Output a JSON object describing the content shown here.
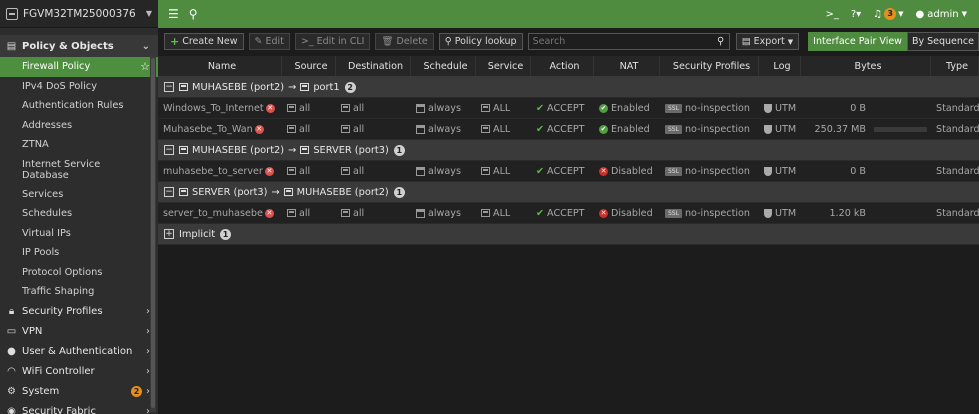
{
  "device": {
    "name": "FGVM32TM25000376"
  },
  "topbar": {
    "notifications": "3",
    "user": "admin"
  },
  "sidebar": {
    "active_section": "Policy & Objects",
    "items": [
      {
        "label": "Firewall Policy"
      },
      {
        "label": "IPv4 DoS Policy"
      },
      {
        "label": "Authentication Rules"
      },
      {
        "label": "Addresses"
      },
      {
        "label": "ZTNA"
      },
      {
        "label": "Internet Service Database"
      },
      {
        "label": "Services"
      },
      {
        "label": "Schedules"
      },
      {
        "label": "Virtual IPs"
      },
      {
        "label": "IP Pools"
      },
      {
        "label": "Protocol Options"
      },
      {
        "label": "Traffic Shaping"
      }
    ],
    "sections": [
      {
        "label": "Security Profiles"
      },
      {
        "label": "VPN"
      },
      {
        "label": "User & Authentication"
      },
      {
        "label": "WiFi Controller"
      },
      {
        "label": "System",
        "badge": "2"
      },
      {
        "label": "Security Fabric"
      }
    ]
  },
  "toolbar": {
    "create_new": "Create New",
    "edit": "Edit",
    "edit_cli": "Edit in CLI",
    "delete": "Delete",
    "policy_lookup": "Policy lookup",
    "search_placeholder": "Search",
    "export": "Export",
    "view_interface_pair": "Interface Pair View",
    "view_by_sequence": "By Sequence"
  },
  "table": {
    "columns": [
      "Name",
      "Source",
      "Destination",
      "Schedule",
      "Service",
      "Action",
      "NAT",
      "Security Profiles",
      "Log",
      "Bytes",
      "Type"
    ],
    "groups": [
      {
        "src_if": "MUHASEBE (port2)",
        "dst_if": "port1",
        "count": "2",
        "policies": [
          {
            "name": "Windows_To_Internet",
            "source": "all",
            "destination": "all",
            "schedule": "always",
            "service": "ALL",
            "action": "ACCEPT",
            "nat": "Enabled",
            "nat_enabled": true,
            "profile": "no-inspection",
            "ssl": "SSL",
            "log": "UTM",
            "bytes": "0 B",
            "type": "Standard"
          },
          {
            "name": "Muhasebe_To_Wan",
            "source": "all",
            "destination": "all",
            "schedule": "always",
            "service": "ALL",
            "action": "ACCEPT",
            "nat": "Enabled",
            "nat_enabled": true,
            "profile": "no-inspection",
            "ssl": "SSL",
            "log": "UTM",
            "bytes": "250.37 MB",
            "type": "Standard"
          }
        ]
      },
      {
        "src_if": "MUHASEBE (port2)",
        "dst_if": "SERVER (port3)",
        "count": "1",
        "policies": [
          {
            "name": "muhasebe_to_server",
            "source": "all",
            "destination": "all",
            "schedule": "always",
            "service": "ALL",
            "action": "ACCEPT",
            "nat": "Disabled",
            "nat_enabled": false,
            "profile": "no-inspection",
            "ssl": "SSL",
            "log": "UTM",
            "bytes": "0 B",
            "type": "Standard"
          }
        ]
      },
      {
        "src_if": "SERVER (port3)",
        "dst_if": "MUHASEBE (port2)",
        "count": "1",
        "policies": [
          {
            "name": "server_to_muhasebe",
            "source": "all",
            "destination": "all",
            "schedule": "always",
            "service": "ALL",
            "action": "ACCEPT",
            "nat": "Disabled",
            "nat_enabled": false,
            "profile": "no-inspection",
            "ssl": "SSL",
            "log": "UTM",
            "bytes": "1.20 kB",
            "type": "Standard"
          }
        ]
      }
    ],
    "implicit": {
      "label": "Implicit",
      "count": "1"
    }
  },
  "colors": {
    "accent": "#4f8c3f",
    "danger": "#d9534f",
    "badge": "#e3901f"
  }
}
